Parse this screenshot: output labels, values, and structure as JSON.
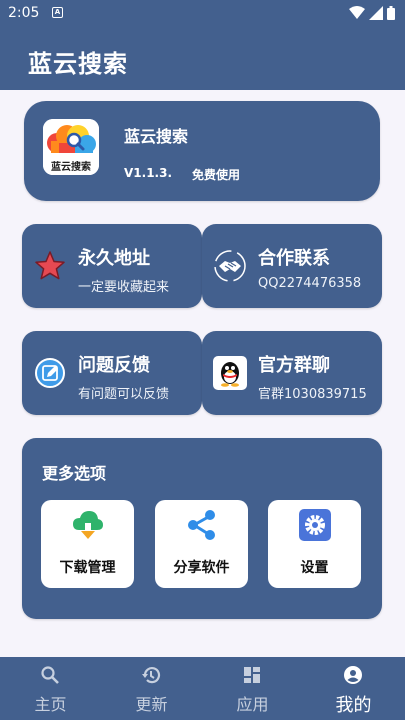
{
  "status_bar": {
    "time": "2:05",
    "notification_icon": "A"
  },
  "app_bar": {
    "title": "蓝云搜索"
  },
  "app_info": {
    "name": "蓝云搜索",
    "version": "V1.1.3.",
    "license": "免费使用",
    "logo_text": "蓝云搜索"
  },
  "tiles": [
    {
      "title": "永久地址",
      "subtitle": "一定要收藏起来",
      "icon": "star-icon"
    },
    {
      "title": "合作联系",
      "subtitle": "QQ2274476358",
      "icon": "handshake-icon"
    },
    {
      "title": "问题反馈",
      "subtitle": "有问题可以反馈",
      "icon": "edit-icon"
    },
    {
      "title": "官方群聊",
      "subtitle": "官群1030839715",
      "icon": "penguin-icon"
    }
  ],
  "more": {
    "title": "更多选项",
    "options": [
      {
        "label": "下载管理",
        "icon": "download-icon"
      },
      {
        "label": "分享软件",
        "icon": "share-icon"
      },
      {
        "label": "设置",
        "icon": "settings-icon"
      }
    ]
  },
  "nav": [
    {
      "label": "主页",
      "icon": "search-icon",
      "active": false
    },
    {
      "label": "更新",
      "icon": "history-icon",
      "active": false
    },
    {
      "label": "应用",
      "icon": "dashboard-icon",
      "active": false
    },
    {
      "label": "我的",
      "icon": "account-icon",
      "active": true
    }
  ],
  "colors": {
    "primary": "#43608e",
    "background": "#f6f4fb",
    "card_white": "#ffffff"
  }
}
